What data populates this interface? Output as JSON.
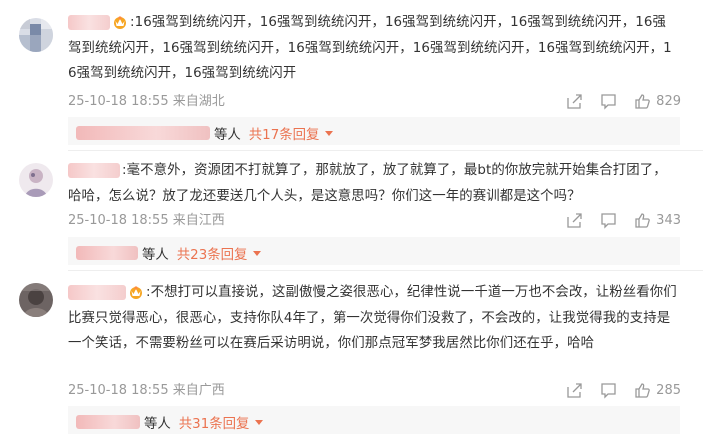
{
  "comments": [
    {
      "text": ":16强驾到统统闪开，16强驾到统统闪开，16强驾到统统闪开，16强驾到统统闪开，16强驾到统统闪开，16强驾到统统闪开，16强驾到统统闪开，16强驾到统统闪开，16强驾到统统闪开，16强驾到统统闪开，16强驾到统统闪开",
      "time": "25-10-18 18:55 来自湖北",
      "likes": "829",
      "reply_who": "等人",
      "reply_count": "共17条回复",
      "has_crown": true
    },
    {
      "text": ":毫不意外，资源团不打就算了，那就放了，放了就算了，最bt的你放完就开始集合打团了，哈哈，怎么说？放了龙还要送几个人头，是这意思吗？你们这一年的赛训都是这个吗？",
      "time": "25-10-18 18:55 来自江西",
      "likes": "343",
      "reply_who": "等人",
      "reply_count": "共23条回复",
      "has_crown": false
    },
    {
      "text": ":不想打可以直接说，这副傲慢之姿很恶心，纪律性说一千道一万也不会改，让粉丝看你们比赛只觉得恶心，很恶心，支持你队4年了，第一次觉得你们没救了，不会改的，让我觉得我的支持是一个笑话，不需要粉丝可以在赛后采访明说，你们那点冠军梦我居然比你们还在乎，哈哈",
      "time": "25-10-18 18:55 来自广西",
      "likes": "285",
      "reply_who": "等人",
      "reply_count": "共31条回复",
      "has_crown": true
    }
  ],
  "icons": {
    "share": "share-icon",
    "comment": "comment-icon",
    "like": "thumbs-up-icon",
    "crown": "crown-badge-icon",
    "caret": "caret-down-icon"
  },
  "colors": {
    "accent": "#eb7350",
    "meta": "#999999",
    "reply_bg": "#f7f7f7"
  }
}
